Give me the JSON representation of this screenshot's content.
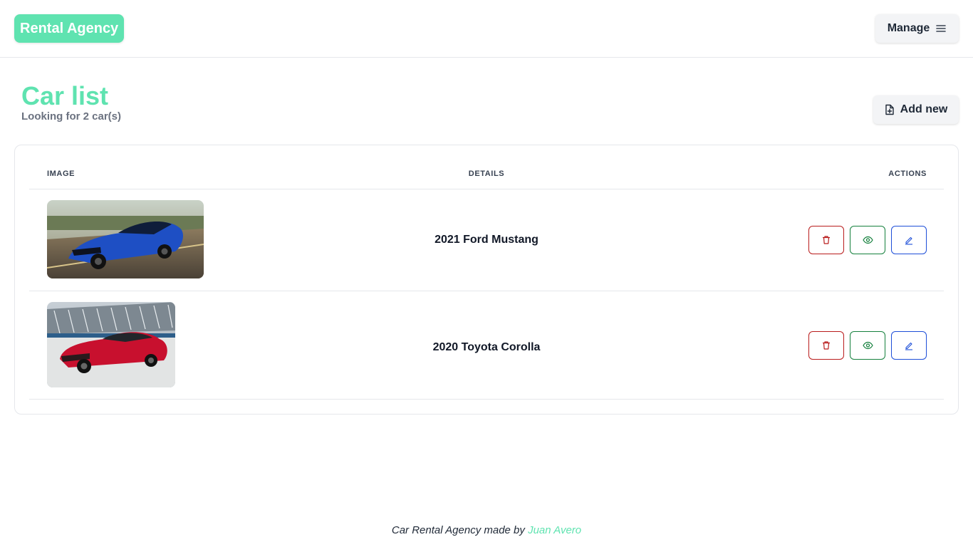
{
  "brand": {
    "label": "Rental Agency",
    "color": "#5fe3b0"
  },
  "nav": {
    "manage_label": "Manage",
    "manage_icon": "hamburger-menu-icon"
  },
  "page": {
    "title": "Car list",
    "subtitle": "Looking for 2 car(s)",
    "add_label": "Add new",
    "add_icon": "file-plus-icon"
  },
  "table": {
    "headers": {
      "image": "IMAGE",
      "details": "DETAILS",
      "actions": "ACTIONS"
    },
    "rows": [
      {
        "name": "2021 Ford Mustang",
        "image": "blue-sports-car-photo",
        "actions": [
          "trash-icon",
          "eye-icon",
          "pencil-icon"
        ]
      },
      {
        "name": "2020 Toyota Corolla",
        "image": "red-sedan-photo",
        "actions": [
          "trash-icon",
          "eye-icon",
          "pencil-icon"
        ]
      }
    ]
  },
  "footer": {
    "text": "Car Rental Agency made by",
    "author": "Juan Avero"
  },
  "colors": {
    "accent": "#5fe3b0",
    "danger": "#b91c1c",
    "success": "#15803d",
    "primary": "#1d4ed8"
  }
}
